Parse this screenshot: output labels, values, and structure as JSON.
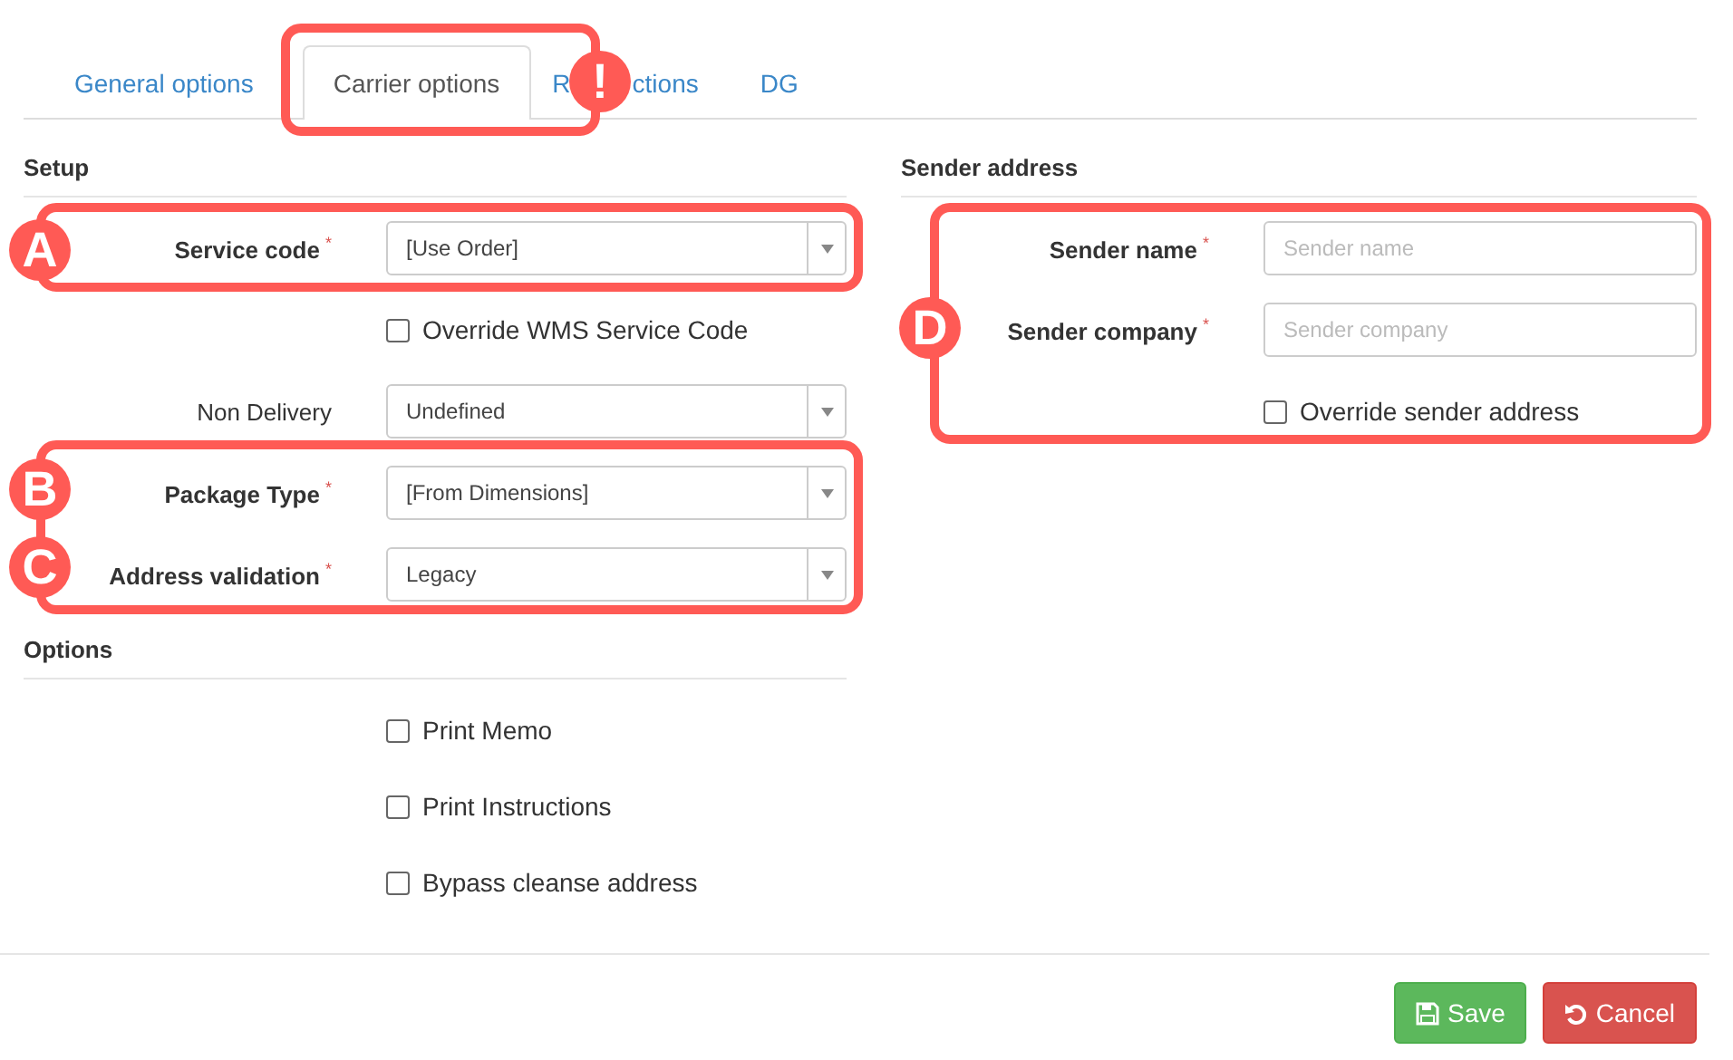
{
  "tabs": [
    {
      "label": "General options",
      "selected": false
    },
    {
      "label": "Carrier options",
      "selected": true
    },
    {
      "label": "R",
      "label_after_badge": "ctions",
      "selected": false
    },
    {
      "label": "DG",
      "selected": false
    }
  ],
  "required_mark": "*",
  "setup": {
    "title": "Setup",
    "rows": [
      {
        "kind": "select",
        "label": "Service code",
        "required": true,
        "value": "[Use Order]"
      },
      {
        "kind": "checkbox",
        "label": "Override WMS Service Code",
        "checked": false
      },
      {
        "kind": "select",
        "label": "Non Delivery",
        "required": false,
        "value": "Undefined"
      },
      {
        "kind": "select",
        "label": "Package Type",
        "required": true,
        "value": "[From Dimensions]"
      },
      {
        "kind": "select",
        "label": "Address validation",
        "required": true,
        "value": "Legacy"
      }
    ]
  },
  "options": {
    "title": "Options",
    "rows": [
      {
        "kind": "checkbox",
        "label": "Print Memo",
        "checked": false
      },
      {
        "kind": "checkbox",
        "label": "Print Instructions",
        "checked": false
      },
      {
        "kind": "checkbox",
        "label": "Bypass cleanse address",
        "checked": false
      }
    ]
  },
  "sender": {
    "title": "Sender address",
    "rows": [
      {
        "kind": "input",
        "label": "Sender name",
        "required": true,
        "placeholder": "Sender name"
      },
      {
        "kind": "input",
        "label": "Sender company",
        "required": true,
        "placeholder": "Sender company"
      },
      {
        "kind": "checkbox",
        "label": "Override sender address",
        "checked": false
      }
    ]
  },
  "buttons": [
    {
      "kind": "save",
      "label": "Save"
    },
    {
      "kind": "cancel",
      "label": "Cancel"
    }
  ],
  "annotations": [
    {
      "kind": "box"
    },
    {
      "kind": "box"
    },
    {
      "kind": "box"
    },
    {
      "kind": "box"
    },
    {
      "kind": "marker",
      "text": "!"
    },
    {
      "kind": "marker",
      "text": "A"
    },
    {
      "kind": "marker",
      "text": "B"
    },
    {
      "kind": "marker",
      "text": "C"
    },
    {
      "kind": "marker",
      "text": "D"
    }
  ]
}
